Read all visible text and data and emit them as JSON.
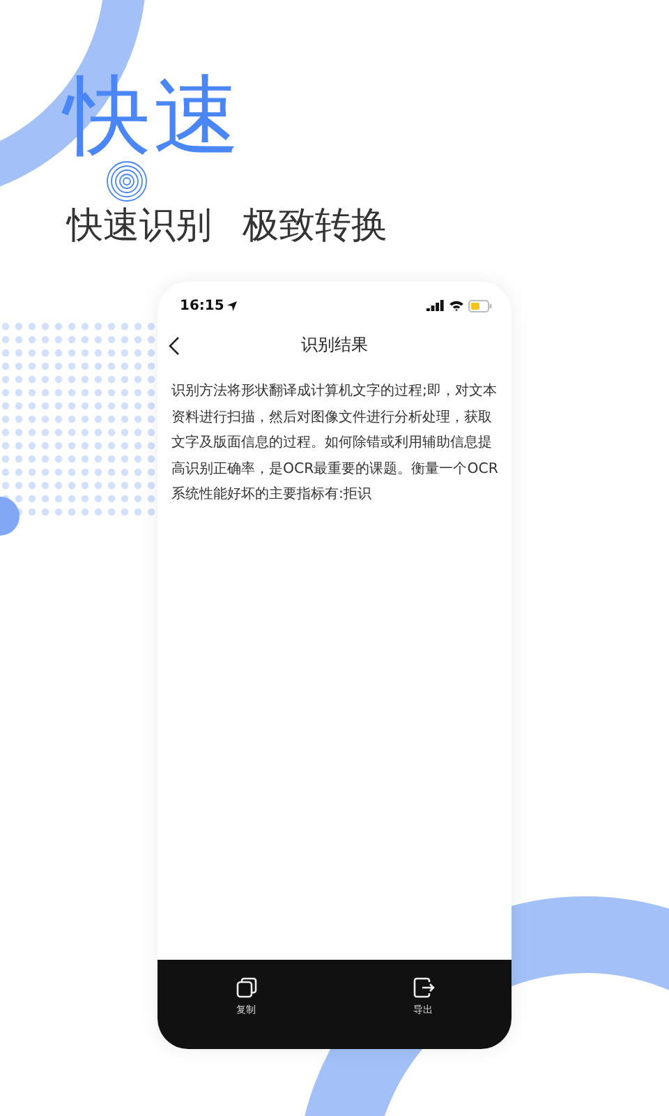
{
  "headline": "快速",
  "tagline": [
    "快速识别",
    "极致转换"
  ],
  "phone": {
    "status_bar": {
      "time": "16:15"
    },
    "title": "识别结果",
    "body": "识别方法将形状翻译成计算机文字的过程;即，对文本资料进行扫描，然后对图像文件进行分析处理，获取文字及版面信息的过程。如何除错或利用辅助信息提高识别正确率，是OCR最重要的课题。衡量一个OCR系统性能好坏的主要指标有:拒识",
    "actions": [
      {
        "kind": "copy",
        "label": "复制"
      },
      {
        "kind": "export",
        "label": "导出"
      }
    ]
  }
}
